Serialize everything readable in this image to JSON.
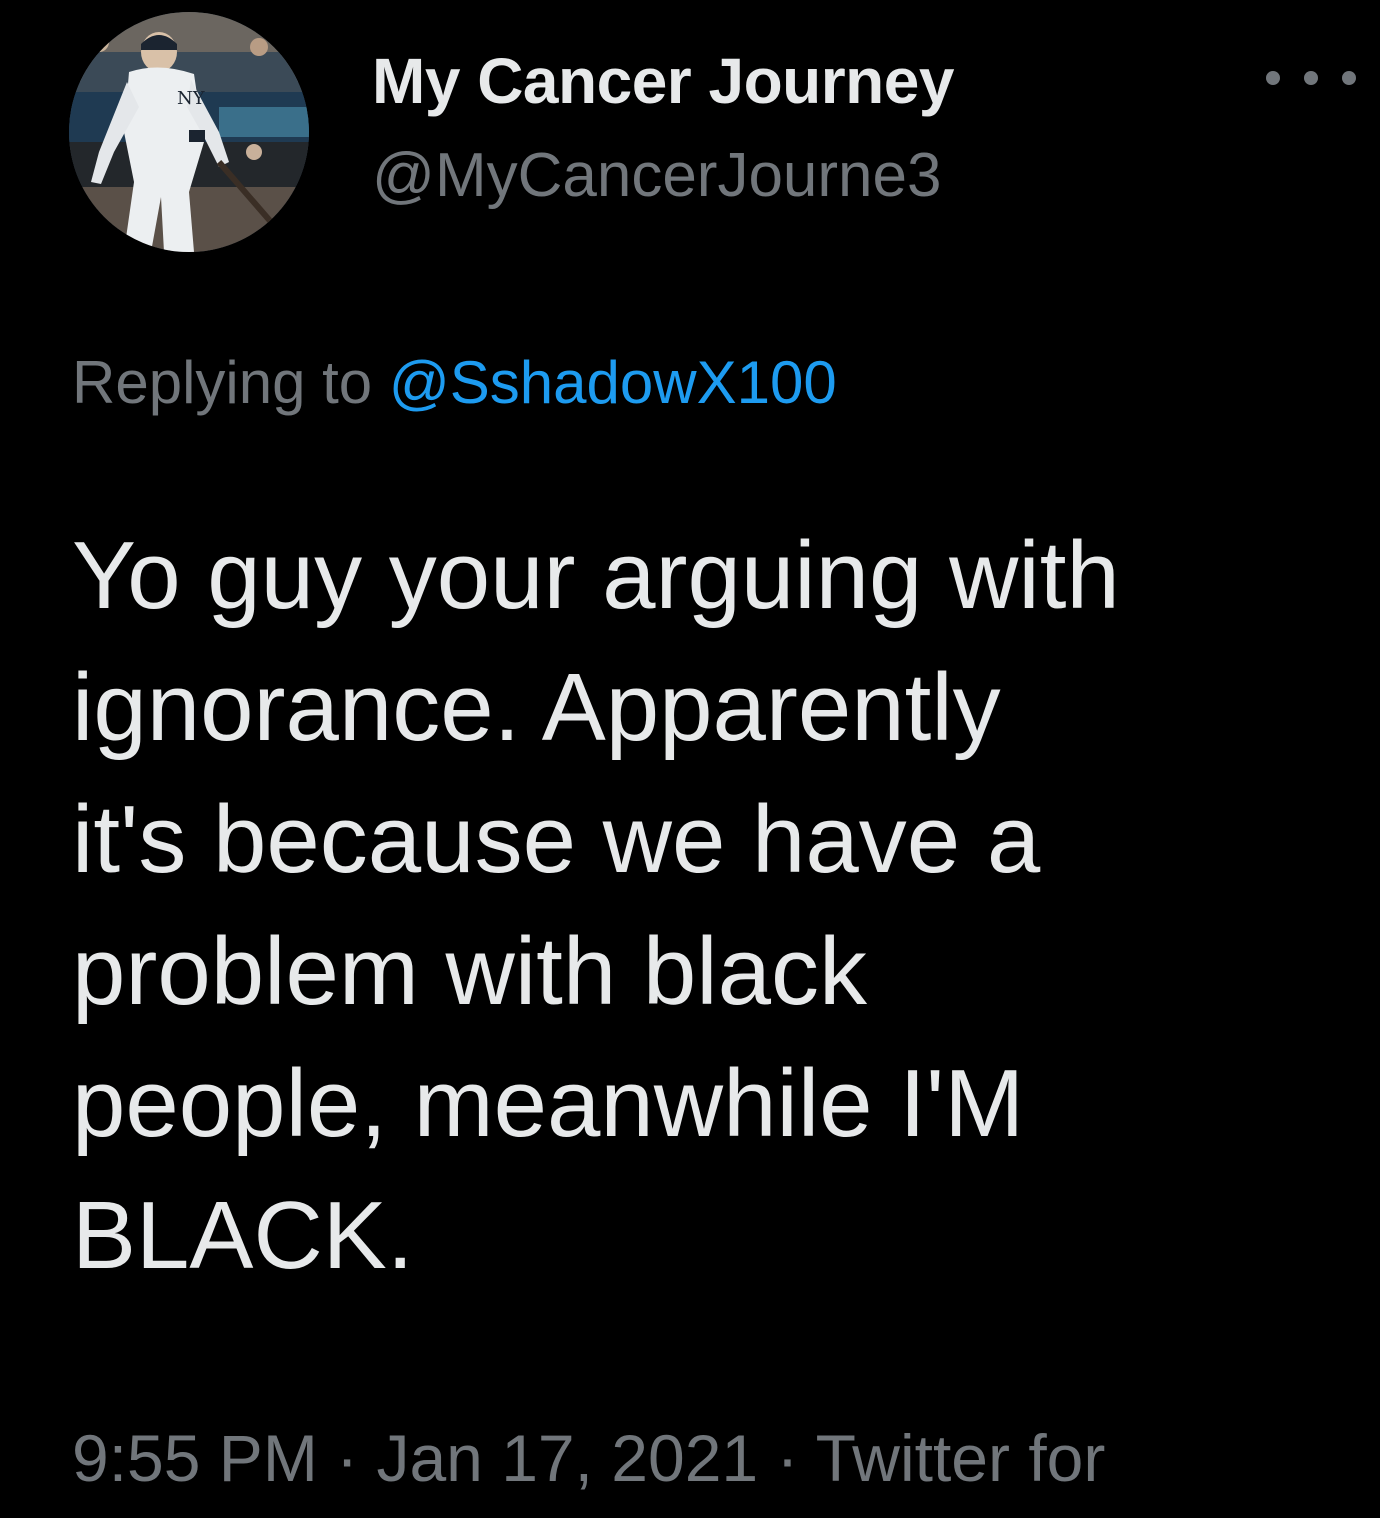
{
  "author": {
    "display_name": "My Cancer Journey",
    "handle": "@MyCancerJourne3"
  },
  "reply": {
    "prefix": "Replying to",
    "mention": "@SshadowX100"
  },
  "tweet": {
    "lines": [
      "Yo guy your arguing with",
      "ignorance. Apparently",
      "it's because we have a",
      "problem with black",
      "people, meanwhile I'M",
      "BLACK."
    ]
  },
  "meta": {
    "time": "9:55 PM",
    "separator": "·",
    "date": "Jan 17, 2021",
    "source": "Twitter for"
  },
  "icons": {
    "more": "more-options-icon",
    "avatar": "avatar-photo"
  },
  "colors": {
    "background": "#000000",
    "primary_text": "#e7e9ea",
    "secondary_text": "#71767b",
    "link": "#1d9bf0"
  }
}
